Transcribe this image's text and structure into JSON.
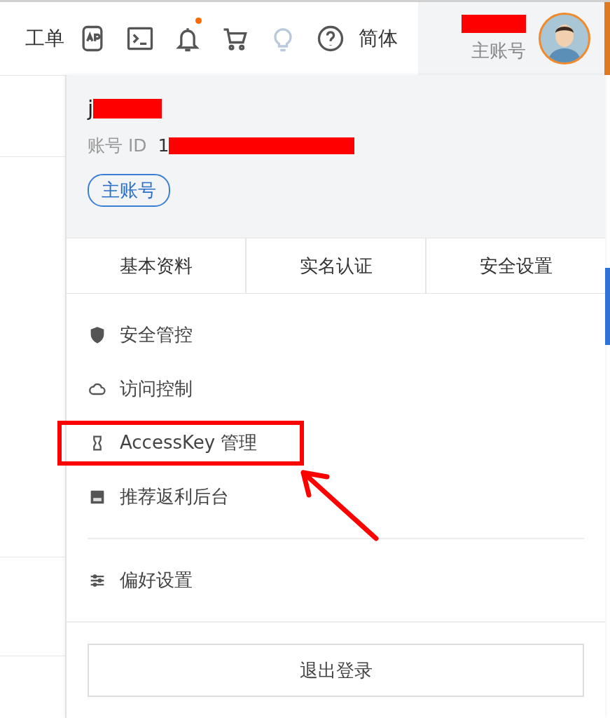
{
  "topbar": {
    "items": [
      {
        "kind": "text",
        "label": "工单"
      },
      {
        "kind": "api"
      },
      {
        "kind": "terminal"
      },
      {
        "kind": "bell",
        "badge": true
      },
      {
        "kind": "cart"
      },
      {
        "kind": "bulb"
      },
      {
        "kind": "help"
      },
      {
        "kind": "text",
        "label": "简体"
      }
    ],
    "account": {
      "redacted": true,
      "role": "主账号"
    }
  },
  "dropdown": {
    "name": "j",
    "name_redacted": true,
    "id_label": "账号 ID",
    "id_value": "1",
    "id_redacted": true,
    "role_tag": "主账号",
    "tabs": [
      "基本资料",
      "实名认证",
      "安全设置"
    ],
    "menu": [
      {
        "kind": "shield",
        "label": "安全管控",
        "highlighted": false
      },
      {
        "kind": "cloud",
        "label": "访问控制",
        "highlighted": false
      },
      {
        "kind": "key",
        "label": "AccessKey 管理",
        "highlighted": true
      },
      {
        "kind": "card",
        "label": "推荐返利后台",
        "highlighted": false
      }
    ],
    "settings": [
      {
        "kind": "sliders",
        "label": "偏好设置",
        "highlighted": false
      }
    ],
    "logout": "退出登录"
  }
}
